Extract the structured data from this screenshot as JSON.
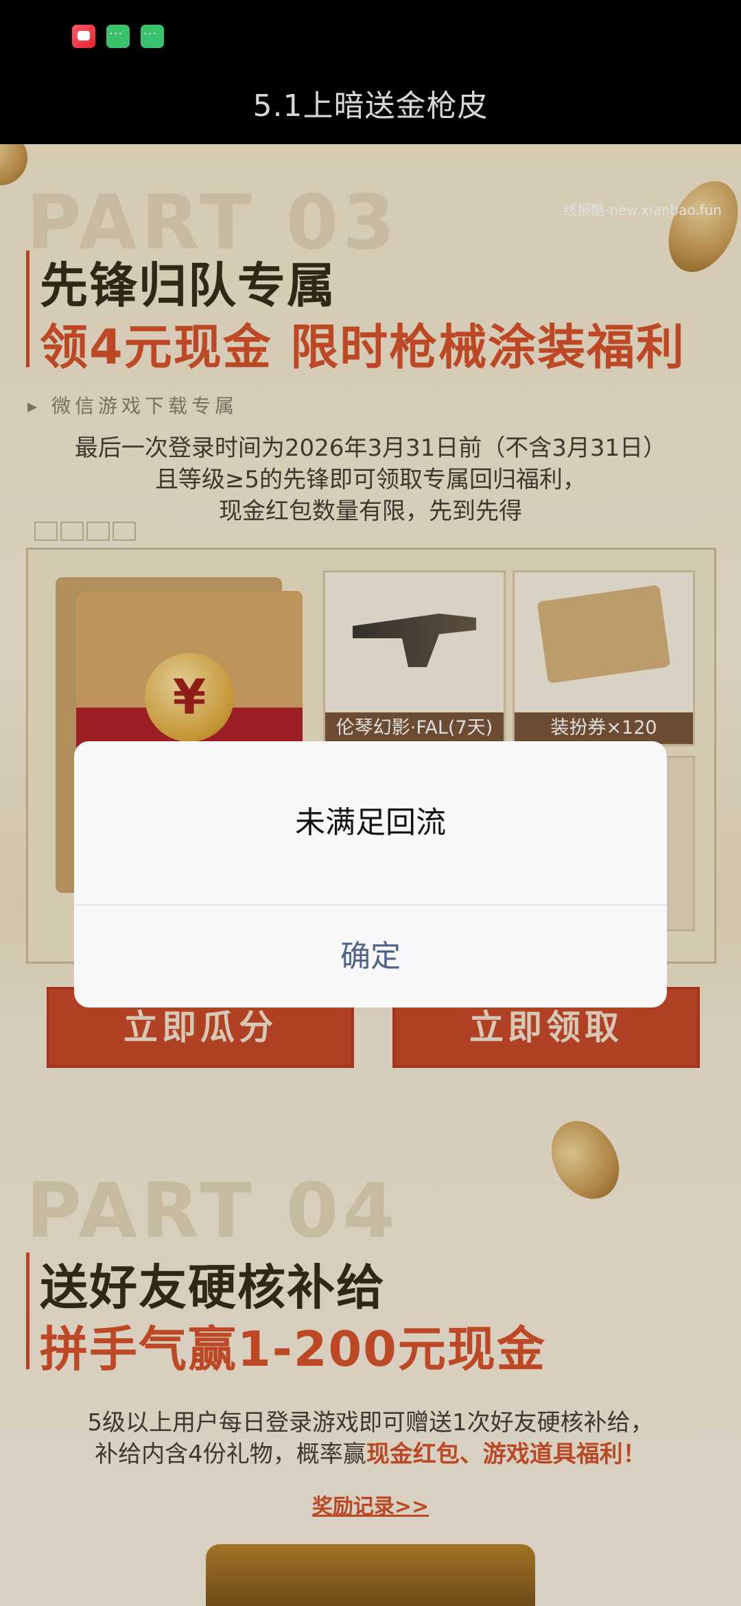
{
  "header": {
    "title": "5.1上暗送金枪皮"
  },
  "watermark": "线报酷-new.xianbao.fun",
  "part3": {
    "bg_text": "PART 03",
    "heading_line1": "先锋归队专属",
    "heading_line2": "领4元现金 限时枪械涂装福利",
    "subtitle": "微信游戏下载专属",
    "desc_line1": "最后一次登录时间为2026年3月31日前（不含3月31日）",
    "desc_line2": "且等级≥5的先锋即可领取专属回归福利，",
    "desc_line3": "现金红包数量有限，先到先得",
    "rewards": [
      {
        "label": "伦琴幻影·FAL(7天)"
      },
      {
        "label": "装扮券×120"
      }
    ],
    "envelope_symbol": "¥",
    "cta_left": "立即瓜分",
    "cta_right": "立即领取"
  },
  "part4": {
    "bg_text": "PART 04",
    "heading_line1": "送好友硬核补给",
    "heading_line2": "拼手气赢1-200元现金",
    "desc_line1": "5级以上用户每日登录游戏即可赠送1次好友硬核补给，",
    "desc_line2_prefix": "补给内含4份礼物，概率赢",
    "desc_line2_highlight": "现金红包、游戏道具福利！",
    "record_link": "奖励记录>>"
  },
  "dialog": {
    "message": "未满足回流",
    "confirm_label": "确定"
  },
  "colors": {
    "accent_orange": "#d4532b",
    "dialog_button_text": "#4f6486",
    "title_bar_bg": "#000000"
  }
}
